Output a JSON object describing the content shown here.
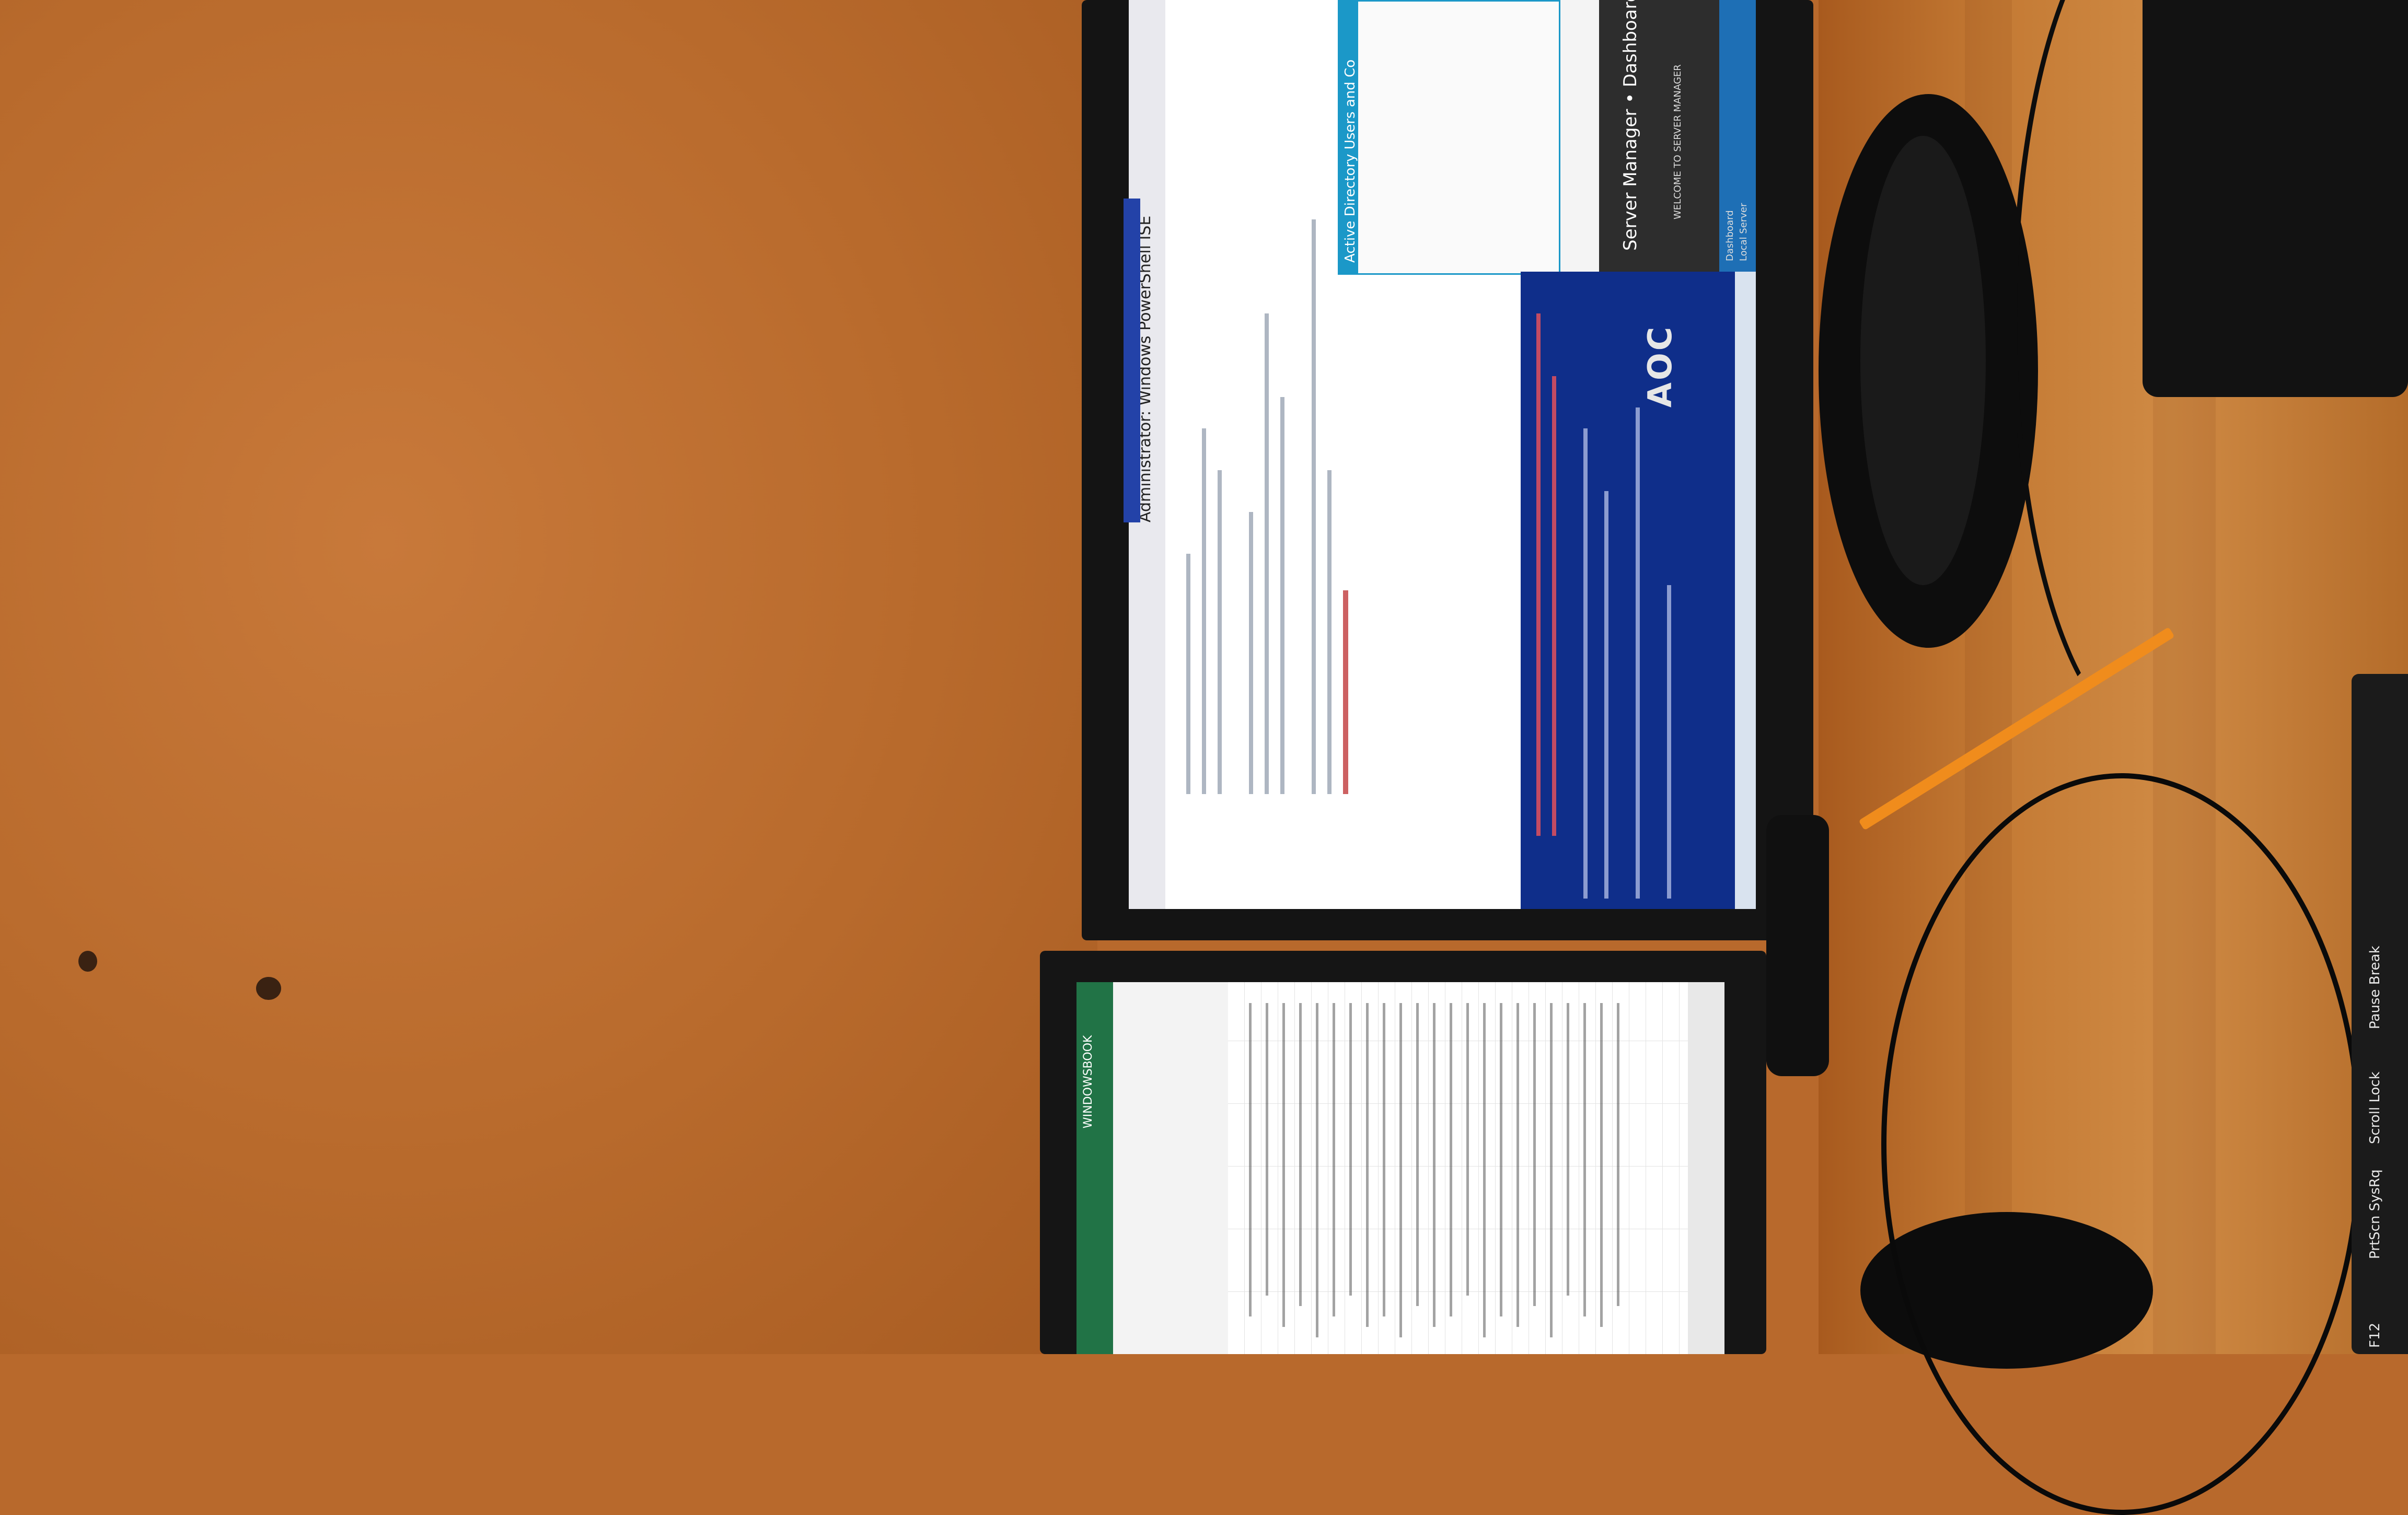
{
  "scene": {
    "description_tags": [
      "wall",
      "desk",
      "two-monitors",
      "keyboard"
    ]
  },
  "monitor1": {
    "brand": "AOC",
    "powershell_window_title": "Administrator: Windows PowerShell ISE",
    "ad_window_title": "Active Directory Users and Co",
    "server_manager_title": "Server Manager • Dashboard",
    "server_manager_welcome": "WELCOME TO SERVER MANAGER",
    "server_manager_nav": [
      "Dashboard",
      "Local Server"
    ]
  },
  "monitor2": {
    "excel_title": "WINDOWSBOOK"
  },
  "keyboard": {
    "keys": [
      "Pause Break",
      "Scroll Lock",
      "PrtScn SysRq",
      "F12"
    ]
  },
  "colors": {
    "wall": "#b8692c",
    "desk": "#c47a34",
    "powershell_console": "#0f2e8a",
    "excel_green": "#217346",
    "ad_accent": "#1b98c8",
    "pencil": "#f08c1c"
  }
}
